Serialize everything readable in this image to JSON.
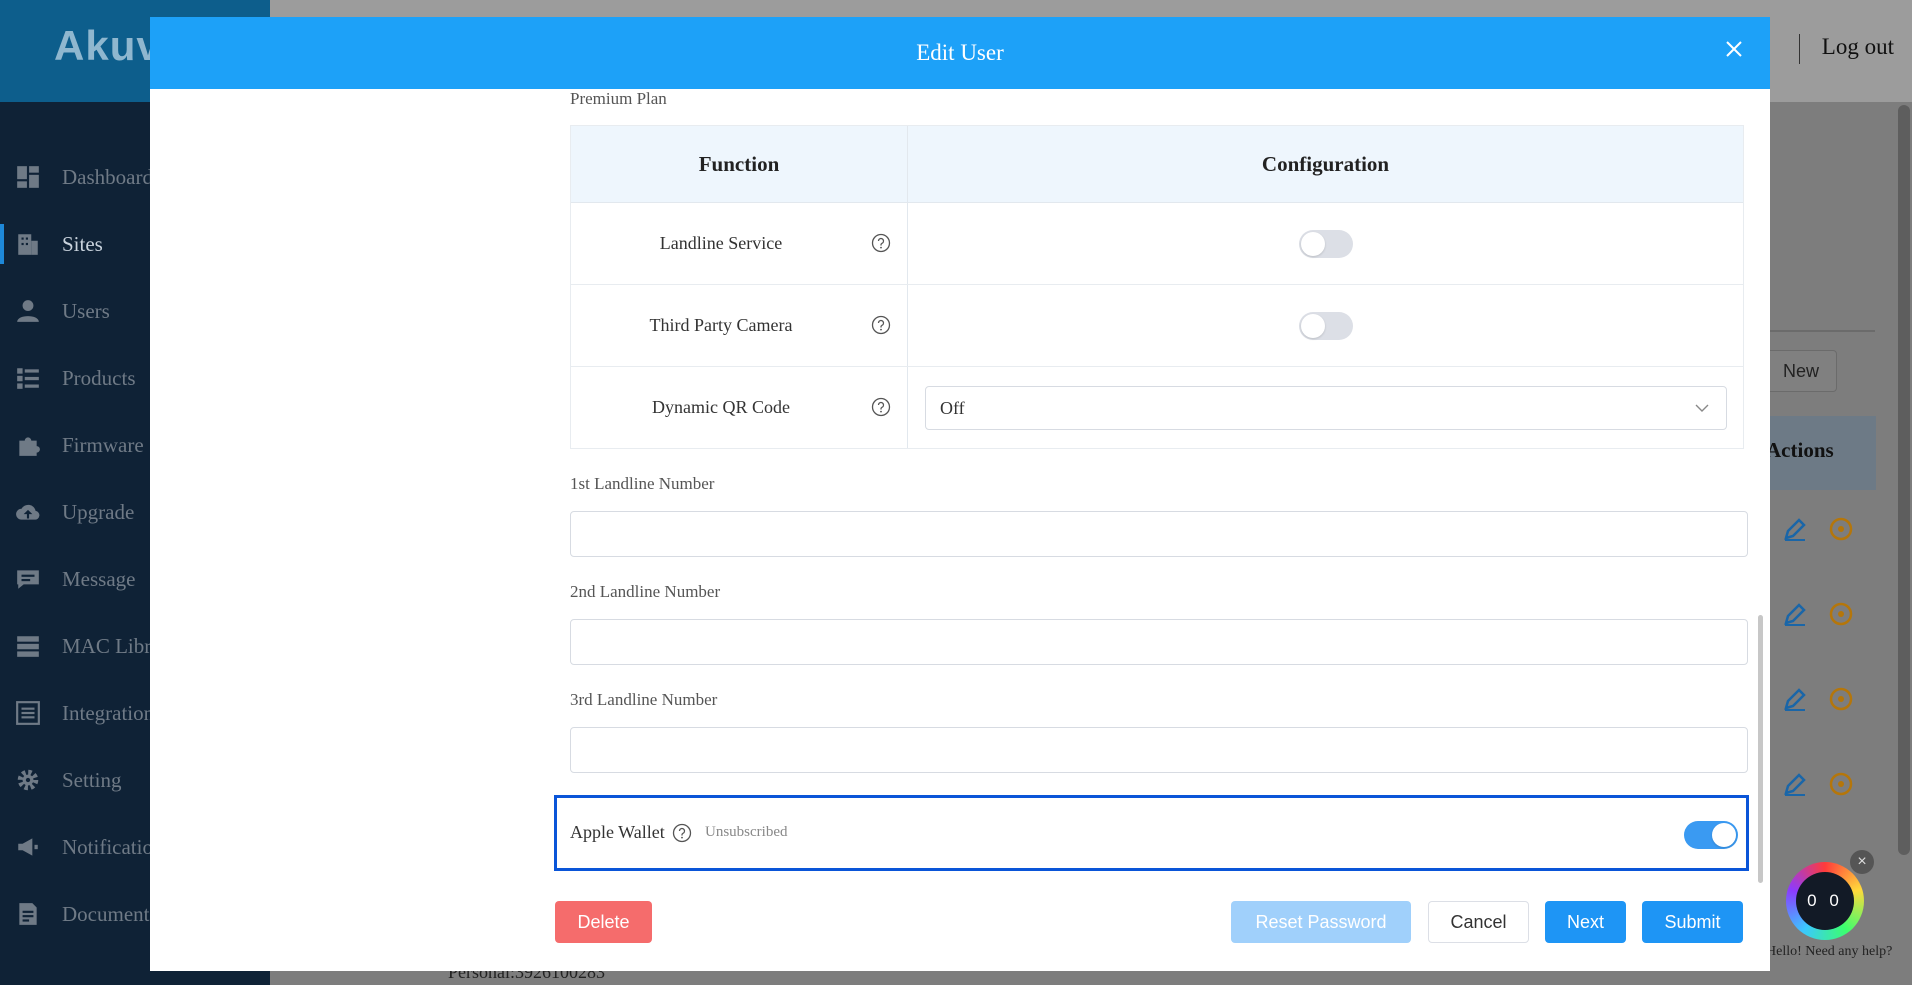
{
  "app": {
    "brand": "Akuv",
    "logout_label": "Log out",
    "sidebar": [
      {
        "label": "Dashboard",
        "icon": "dashboard-icon"
      },
      {
        "label": "Sites",
        "icon": "building-icon"
      },
      {
        "label": "Users",
        "icon": "user-icon"
      },
      {
        "label": "Products",
        "icon": "list-icon"
      },
      {
        "label": "Firmware",
        "icon": "puzzle-icon"
      },
      {
        "label": "Upgrade",
        "icon": "cloud-upload-icon"
      },
      {
        "label": "Message",
        "icon": "message-icon"
      },
      {
        "label": "MAC Libr",
        "icon": "server-icon"
      },
      {
        "label": "Integration",
        "icon": "integration-icon"
      },
      {
        "label": "Setting",
        "icon": "gear-icon"
      },
      {
        "label": "Notificatio",
        "icon": "megaphone-icon"
      },
      {
        "label": "Document",
        "icon": "document-icon"
      }
    ],
    "active_item": "Sites",
    "new_button": "New",
    "actions_header": "Actions",
    "personal_text": "Personal:3926100283",
    "help_text": "Hello! Need any help?",
    "help_bot_face": "0 0"
  },
  "modal": {
    "title": "Edit User",
    "section_label": "Premium Plan",
    "table": {
      "headers": [
        "Function",
        "Configuration"
      ],
      "rows": [
        {
          "name": "Landline Service",
          "control": "toggle",
          "on": false
        },
        {
          "name": "Third Party Camera",
          "control": "toggle",
          "on": false
        },
        {
          "name": "Dynamic QR Code",
          "control": "select",
          "value": "Off"
        }
      ]
    },
    "fields": [
      {
        "label": "1st Landline Number",
        "value": ""
      },
      {
        "label": "2nd Landline Number",
        "value": ""
      },
      {
        "label": "3rd Landline Number",
        "value": ""
      }
    ],
    "apple_wallet": {
      "label": "Apple Wallet",
      "status": "Unsubscribed",
      "on": true
    },
    "buttons": {
      "delete": "Delete",
      "reset_password": "Reset Password",
      "cancel": "Cancel",
      "next": "Next",
      "submit": "Submit"
    }
  },
  "colors": {
    "header_blue": "#1da1f8",
    "primary": "#1e95f5",
    "danger": "#f56c6c",
    "highlight_border": "#0a55d8"
  }
}
